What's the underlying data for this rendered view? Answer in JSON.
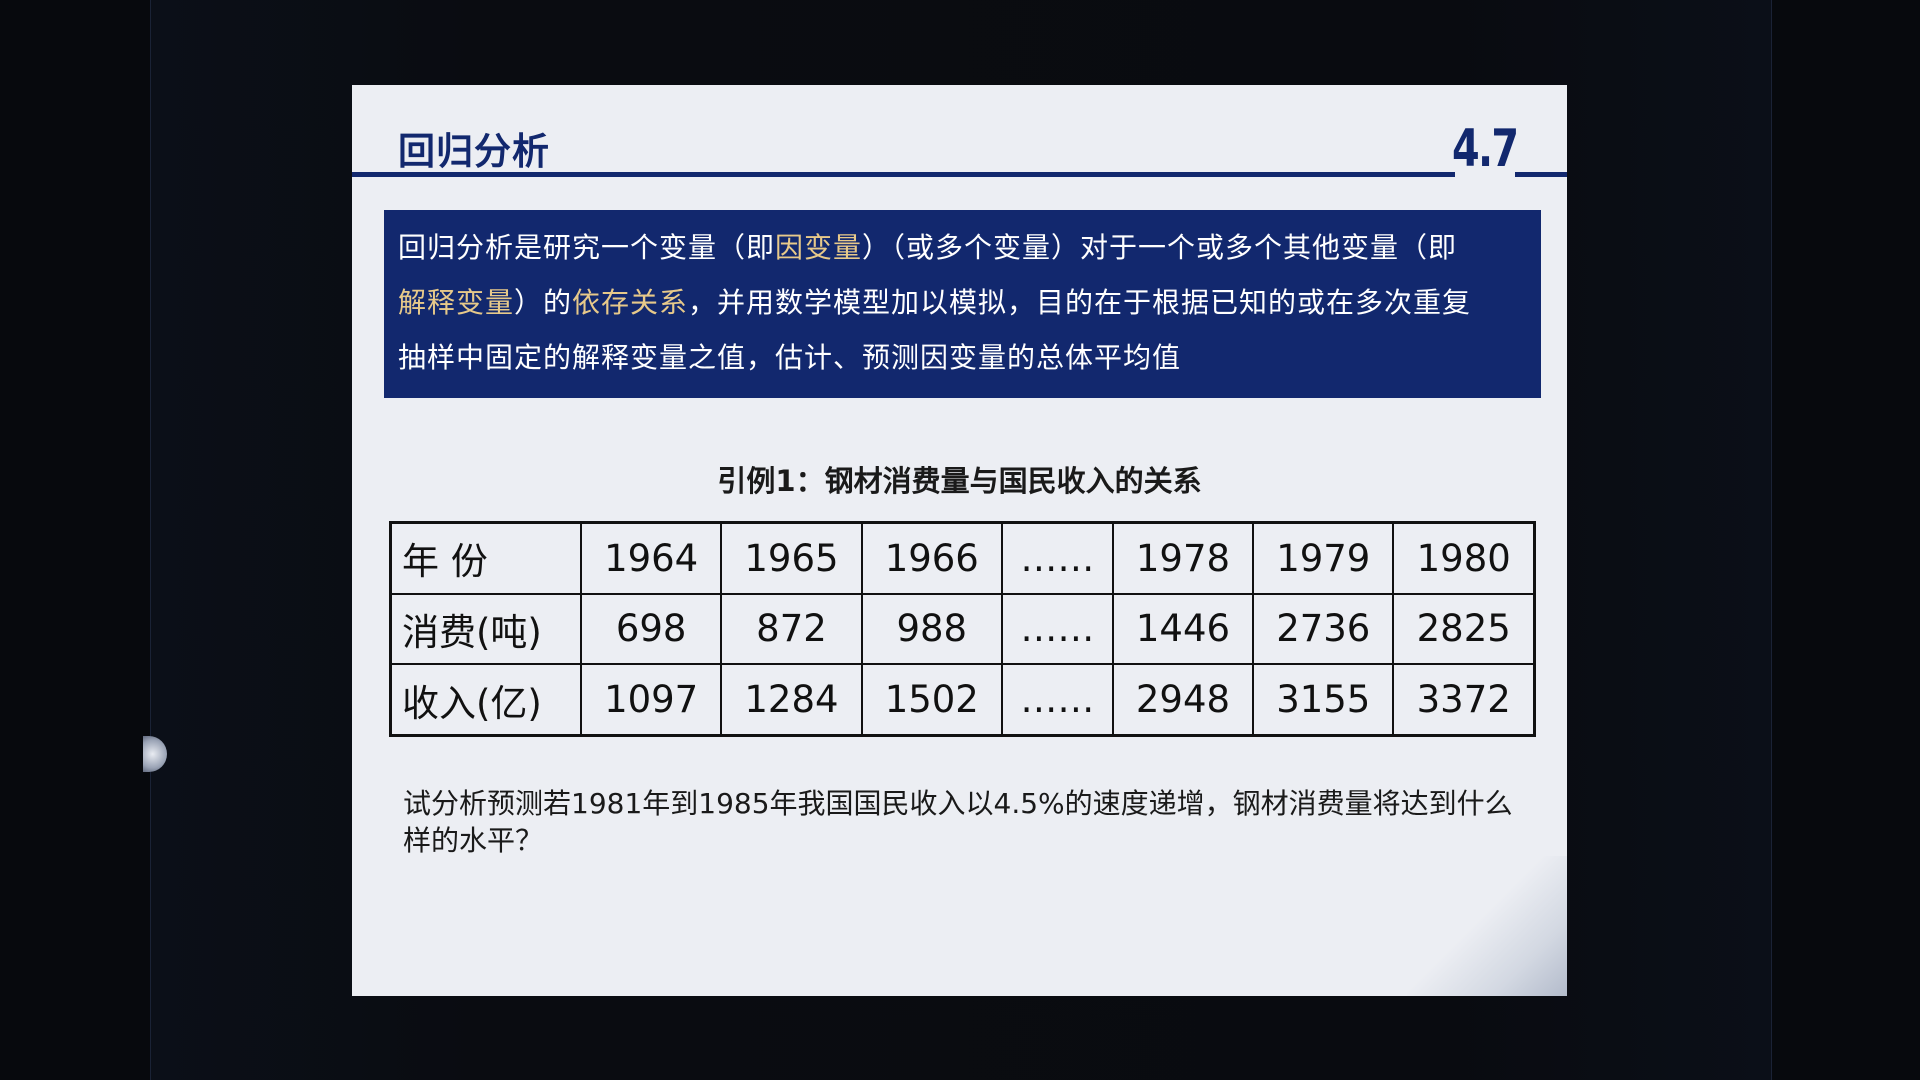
{
  "slide": {
    "title": "回归分析",
    "section_number": "4.7",
    "definition": {
      "line1_a": "回归分析是研究一个变量（即",
      "line1_hl": "因变量",
      "line1_b": "）（或多个变量）对于一个或多个其他变量（即",
      "line2_hl1": "解释变量",
      "line2_a": "）的",
      "line2_hl2": "依存关系",
      "line2_b": "，并用数学模型加以模拟，目的在于根据已知的或在多次重复",
      "line3": "抽样中固定的解释变量之值，估计、预测因变量的总体平均值"
    },
    "table_caption": "引例1：钢材消费量与国民收入的关系",
    "table": {
      "rows": [
        {
          "label": "年  份",
          "cells": [
            "1964",
            "1965",
            "1966",
            "……",
            "1978",
            "1979",
            "1980"
          ]
        },
        {
          "label": "消费(吨)",
          "cells": [
            "698",
            "872",
            "988",
            "……",
            "1446",
            "2736",
            "2825"
          ]
        },
        {
          "label": "收入(亿)",
          "cells": [
            "1097",
            "1284",
            "1502",
            "……",
            "2948",
            "3155",
            "3372"
          ]
        }
      ]
    },
    "question": "试分析预测若1981年到1985年我国国民收入以4.5%的速度递增，钢材消费量将达到什么样的水平？"
  },
  "colors": {
    "accent": "#12286e",
    "highlight": "#e7c98a",
    "slide_bg": "#eceef3",
    "viewer_bg": "#07090d"
  }
}
